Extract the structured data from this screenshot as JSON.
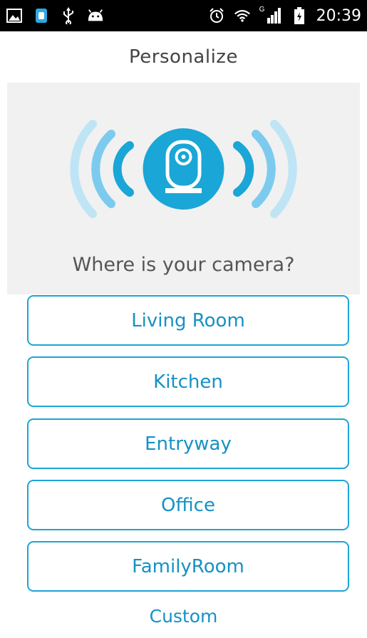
{
  "status_bar": {
    "time": "20:39",
    "signal_label": "G",
    "left_icons": [
      "image-icon",
      "app-notification-icon",
      "usb-icon",
      "android-icon"
    ],
    "right_icons": [
      "alarm-icon",
      "wifi-icon",
      "signal-icon",
      "battery-icon"
    ]
  },
  "header": {
    "title": "Personalize"
  },
  "hero": {
    "icon": "camera-icon",
    "question": "Where is your camera?",
    "accent_color": "#1aa6d6"
  },
  "options": [
    {
      "label": "Living Room"
    },
    {
      "label": "Kitchen"
    },
    {
      "label": "Entryway"
    },
    {
      "label": "Office"
    },
    {
      "label": "FamilyRoom"
    }
  ],
  "custom_label": "Custom"
}
